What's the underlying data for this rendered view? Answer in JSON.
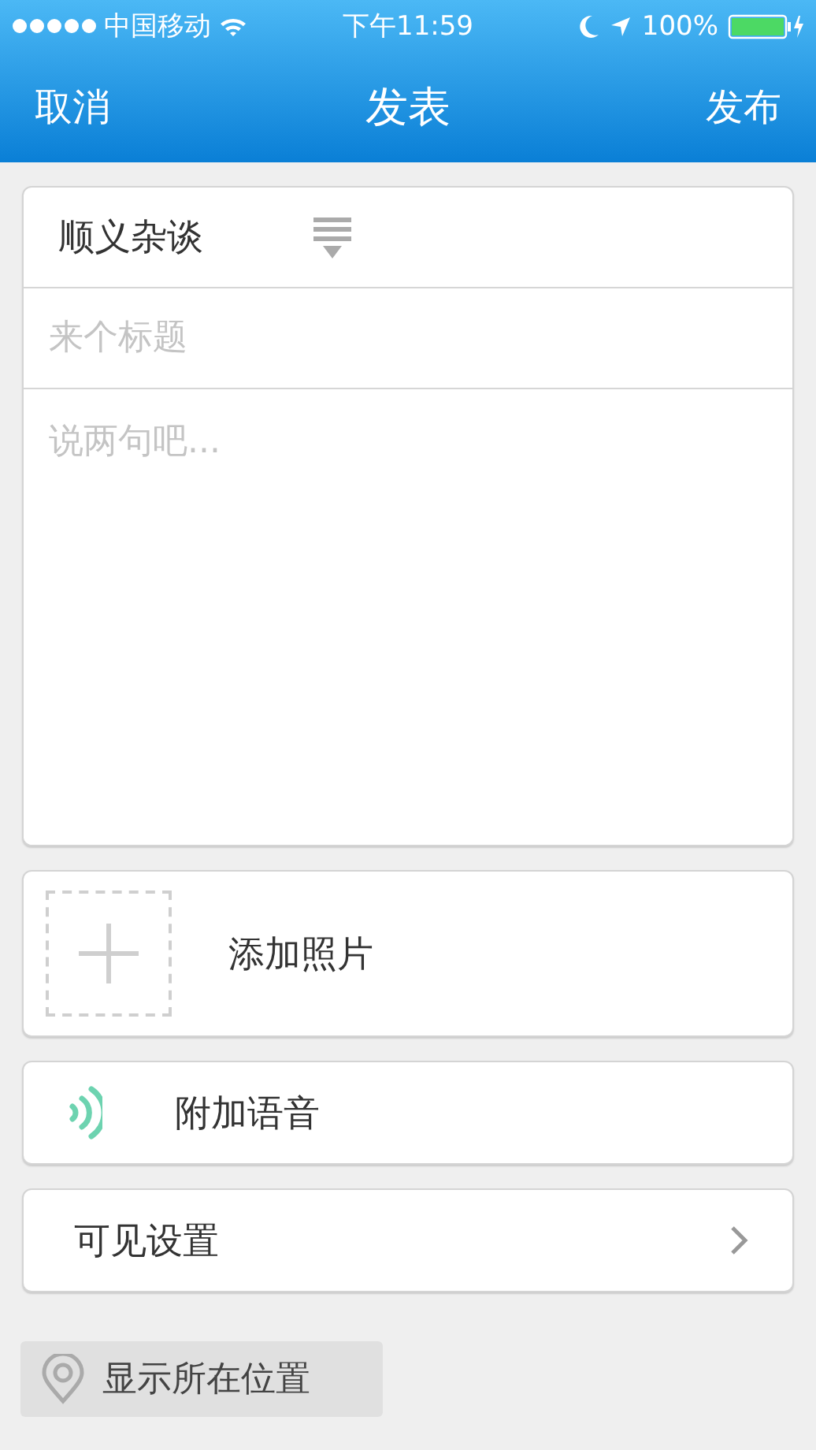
{
  "status_bar": {
    "carrier": "中国移动",
    "time": "下午11:59",
    "battery": "100%"
  },
  "nav": {
    "cancel": "取消",
    "title": "发表",
    "publish": "发布"
  },
  "form": {
    "category": "顺义杂谈",
    "title_field": {
      "placeholder": "来个标题"
    },
    "body_field": {
      "placeholder": "说两句吧..."
    }
  },
  "add_photo": "添加照片",
  "add_voice": "附加语音",
  "visibility": "可见设置",
  "location": "显示所在位置"
}
